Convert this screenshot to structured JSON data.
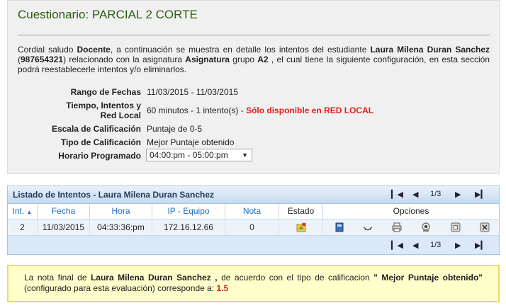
{
  "page": {
    "title": "Cuestionario: PARCIAL 2 CORTE"
  },
  "intro": {
    "t1": "Cordial saludo ",
    "b1": "Docente",
    "t2": ", a continuación se muestra en detalle los intentos del estudiante ",
    "b2": "Laura Milena Duran Sanchez",
    "t3": " (",
    "b3": "987654321",
    "t4": ") relacionado con la asignatura ",
    "b4": "Asignatura",
    "t5": " grupo ",
    "b5": "A2",
    "t6": " , el cual tiene la siguiente configuración, en esta sección podrá reestablecerle intentos y/o eliminarlos."
  },
  "config": {
    "rango_label": "Rango de Fechas",
    "rango_value": "11/03/2015 - 11/03/2015",
    "tiempo_label": "Tiempo, Intentos y Red Local",
    "tiempo_value": "60 minutos - 1 intento(s) - ",
    "tiempo_warning": "Sólo disponible en RED LOCAL",
    "escala_label": "Escala de Calificación",
    "escala_value": "Puntaje de 0-5",
    "tipo_label": "Tipo de Calificación",
    "tipo_value": "Mejor Puntaje obtenido",
    "horario_label": "Horario Programado",
    "horario_selected": "04:00:pm - 05:00:pm"
  },
  "grid": {
    "title": "Listado de Intentos - Laura Milena Duran Sanchez",
    "page_indicator": "1/3",
    "columns": [
      "Int.",
      "Fecha",
      "Hora",
      "IP - Equipo",
      "Nota",
      "Estado",
      "Opciones"
    ],
    "rows": [
      {
        "int": "2",
        "fecha": "11/03/2015",
        "hora": "04:33:36:pm",
        "ip": "172.16.12.66",
        "nota": "0"
      }
    ]
  },
  "note": {
    "t1": "La nota final de ",
    "b1": "Laura Milena Duran Sanchez ,",
    "t2": " de acuerdo con el tipo de calificacion ",
    "b2": "\" Mejor Puntaje obtenido\"",
    "t3": " (configurado para esta evaluación) corresponde a: ",
    "score": "1.5"
  },
  "colors": {
    "title_green": "#2b5d10",
    "warning_red": "#e0201c",
    "grid_blue": "#1f6fc2",
    "note_bg": "#ffffcc"
  },
  "icons": [
    "sort-asc-icon",
    "first-page-icon",
    "prev-page-icon",
    "next-page-icon",
    "last-page-icon",
    "estado-icon",
    "book-icon",
    "expand-icon",
    "print-icon",
    "webcam-icon",
    "restore-icon",
    "delete-icon"
  ]
}
